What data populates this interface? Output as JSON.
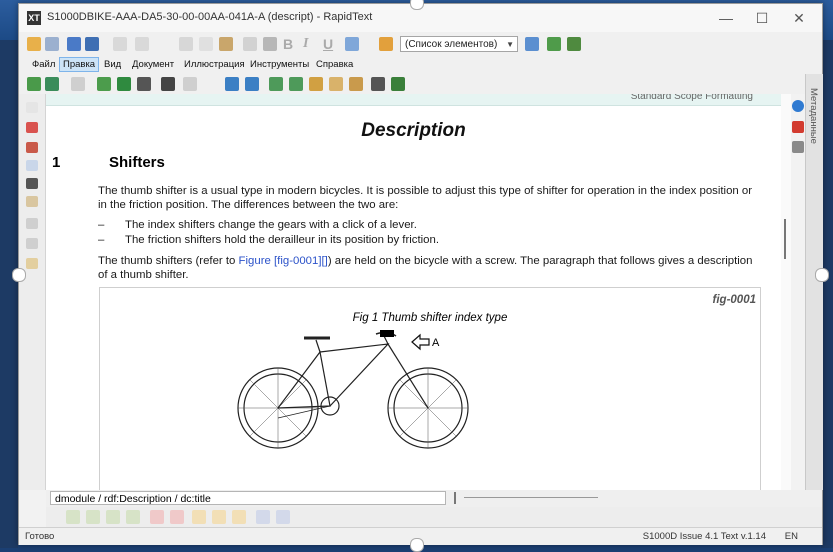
{
  "window": {
    "title": "S1000DBIKE-AAA-DA5-30-00-00AA-041A-A (descript) - RapidText",
    "app_icon_text": "XT",
    "minimize": "—",
    "maximize": "☐",
    "close": "✕"
  },
  "toolbar": {
    "element_list_combo": "(Список элементов)",
    "bold_label": "B",
    "italic_label": "I",
    "underline_label": "U"
  },
  "menu": {
    "items": [
      "Файл",
      "Правка",
      "Вид",
      "Документ",
      "Иллюстрация",
      "Инструменты",
      "Справка"
    ],
    "active_index": 1
  },
  "side_panel": {
    "tab_label": "Метаданные"
  },
  "meta_strip_text": "Standard Scope Formatting",
  "document": {
    "title": "Description",
    "section_number": "1",
    "section_title": "Shifters",
    "para1": "The thumb shifter is a usual type in modern bicycles. It is possible to adjust this type of shifter for operation in the index position or in the friction position. The differences between the two are:",
    "bullets": [
      "The index shifters change the gears with a click of a lever.",
      "The friction shifters hold the derailleur in its position by friction."
    ],
    "bullet_marker": "–",
    "para2_before": "The thumb shifters (refer to ",
    "para2_link": "Figure [fig-0001][]",
    "para2_after": ") are held on the bicycle with a screw. The paragraph that follows gives a description of a thumb shifter.",
    "figure": {
      "id": "fig-0001",
      "caption": "Fig 1 Thumb shifter index type",
      "callout": "A"
    }
  },
  "path_bar": {
    "path": "dmodule / rdf:Description / dc:title"
  },
  "status": {
    "ready": "Готово",
    "info": "S1000D Issue 4.1 Text v.1.14",
    "lang": "EN"
  }
}
